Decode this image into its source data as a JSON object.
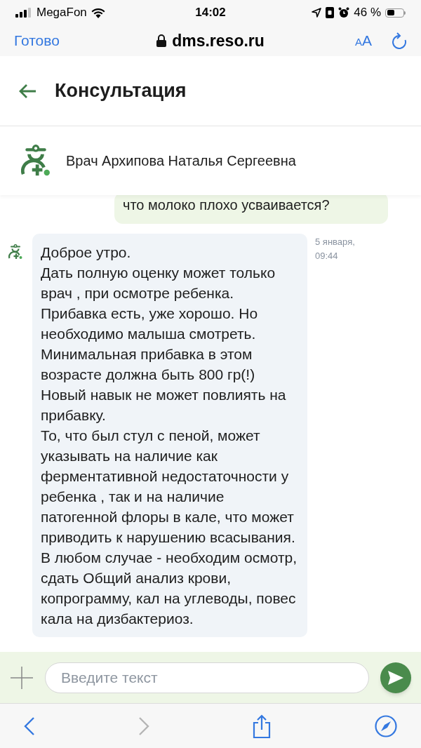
{
  "status_bar": {
    "carrier": "MegaFon",
    "time": "14:02",
    "battery": "46 %"
  },
  "browser": {
    "done": "Готово",
    "url": "dms.reso.ru",
    "text_size": "AA"
  },
  "header": {
    "title": "Консультация"
  },
  "doctor": {
    "name": "Врач Архипова Наталья Сергеевна"
  },
  "messages": [
    {
      "kind": "outgoing",
      "paragraphs": [
        "что молоко плохо усваивается?"
      ]
    },
    {
      "kind": "incoming",
      "date": "5 января,",
      "time": "09:44",
      "paragraphs": [
        "Доброе утро.",
        "Дать полную оценку может только врач , при осмотре ребенка.",
        "Прибавка есть, уже хорошо. Но необходимо малыша смотреть.",
        "Минимальная прибавка в этом возрасте должна быть 800 гр(!)",
        "Новый навык не может повлиять на прибавку.",
        "То, что был стул с пеной, может указывать на наличие как ферментативной недостаточности у ребенка , так и на наличие патогенной флоры в кале, что может приводить к нарушению всасывания.",
        "В любом случае - необходим осмотр, сдать Общий анализ крови, копрограмму, кал на углеводы, повес кала на дизбактериоз."
      ]
    }
  ],
  "composer": {
    "placeholder": "Введите текст"
  }
}
